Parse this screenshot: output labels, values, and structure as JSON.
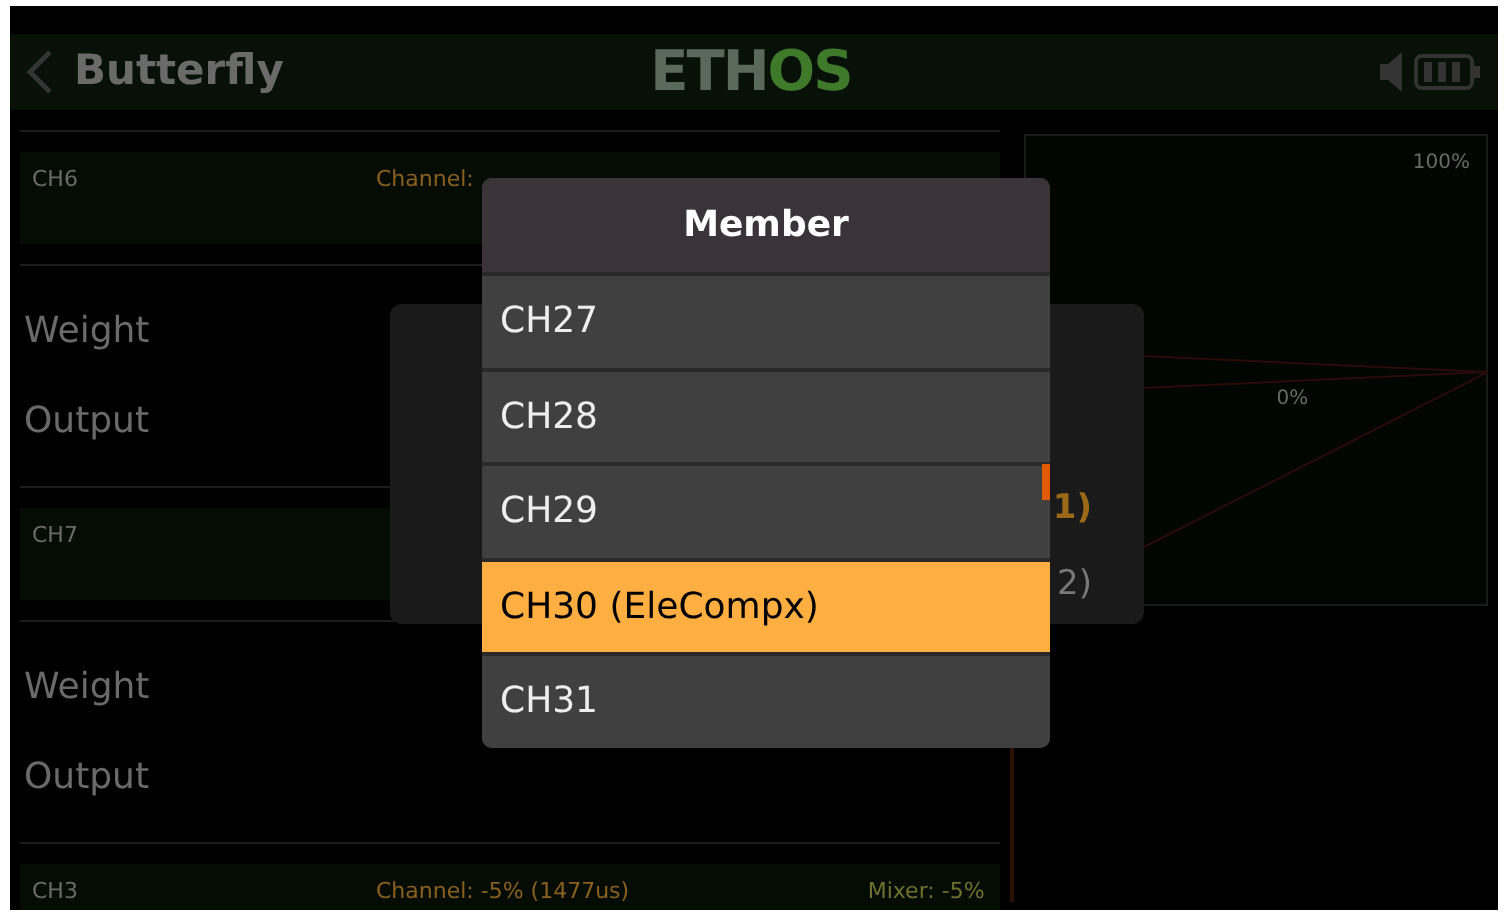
{
  "header": {
    "title": "Butterfly",
    "logo_parts": [
      "ETH",
      "OS"
    ]
  },
  "sections": [
    {
      "kind": "monitor",
      "name": "CH6",
      "channel": "Channel:"
    },
    {
      "kind": "field",
      "label": "Weight"
    },
    {
      "kind": "field",
      "label": "Output"
    },
    {
      "kind": "monitor",
      "name": "CH7"
    },
    {
      "kind": "field",
      "label": "Weight"
    },
    {
      "kind": "field",
      "label": "Output"
    },
    {
      "kind": "monitor",
      "name": "CH3",
      "channel": "Channel: -5% (1477us)",
      "mixer": "Mixer: -5%"
    }
  ],
  "curve": {
    "top_label": "100%",
    "mid_label": "0%"
  },
  "back_dialog": {
    "lines": [
      {
        "text": "1)",
        "kind": "active"
      },
      {
        "text": "2)",
        "kind": "plain"
      }
    ]
  },
  "popup": {
    "title": "Member",
    "items": [
      {
        "label": "CH27",
        "selected": false
      },
      {
        "label": "CH28",
        "selected": false
      },
      {
        "label": "CH29",
        "selected": false
      },
      {
        "label": "CH30 (EleCompx)",
        "selected": true
      },
      {
        "label": "CH31",
        "selected": false
      }
    ]
  }
}
